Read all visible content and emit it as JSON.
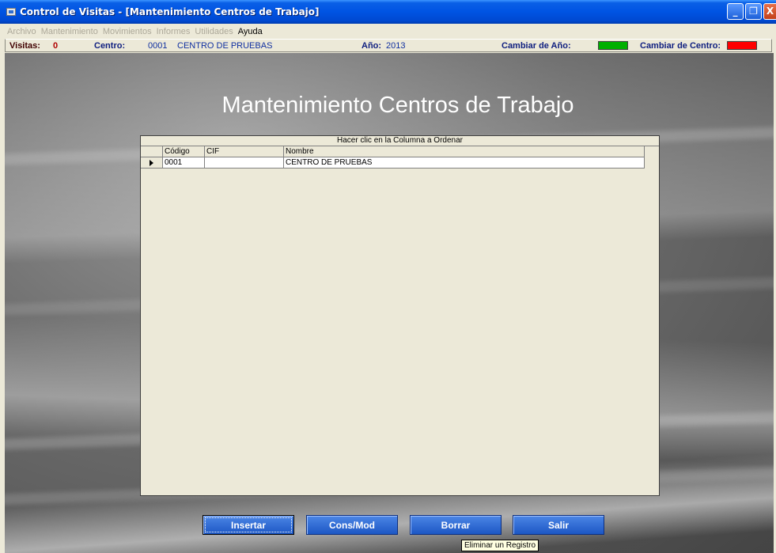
{
  "window": {
    "title": "Control de Visitas - [Mantenimiento Centros de Trabajo]",
    "buttons": [
      "_",
      "❐",
      "X"
    ]
  },
  "menu": {
    "items": [
      {
        "label": "Archivo",
        "enabled": false
      },
      {
        "label": "Mantenimiento",
        "enabled": false
      },
      {
        "label": "Movimientos",
        "enabled": false
      },
      {
        "label": "Informes",
        "enabled": false
      },
      {
        "label": "Utilidades",
        "enabled": false
      },
      {
        "label": "Ayuda",
        "enabled": true
      }
    ]
  },
  "status": {
    "visitas_label": "Visitas:",
    "visitas_value": "0",
    "centro_label": "Centro:",
    "centro_code": "0001",
    "centro_name": "CENTRO DE PRUEBAS",
    "anio_label": "Año:",
    "anio_value": "2013",
    "cambiar_anio_label": "Cambiar de Año:",
    "cambiar_anio_color": "#00b000",
    "cambiar_centro_label": "Cambiar de Centro:",
    "cambiar_centro_color": "#ff0000"
  },
  "main": {
    "page_title": "Mantenimiento Centros de Trabajo",
    "grid": {
      "caption": "Hacer clic en la Columna a Ordenar",
      "columns": [
        "Código",
        "CIF",
        "Nombre"
      ],
      "rows": [
        {
          "codigo": "0001",
          "cif": "",
          "nombre": "CENTRO DE PRUEBAS"
        }
      ]
    },
    "buttons": {
      "insertar": "Insertar",
      "cons_mod": "Cons/Mod",
      "borrar": "Borrar",
      "salir": "Salir"
    },
    "tooltip": "Eliminar un Registro"
  }
}
